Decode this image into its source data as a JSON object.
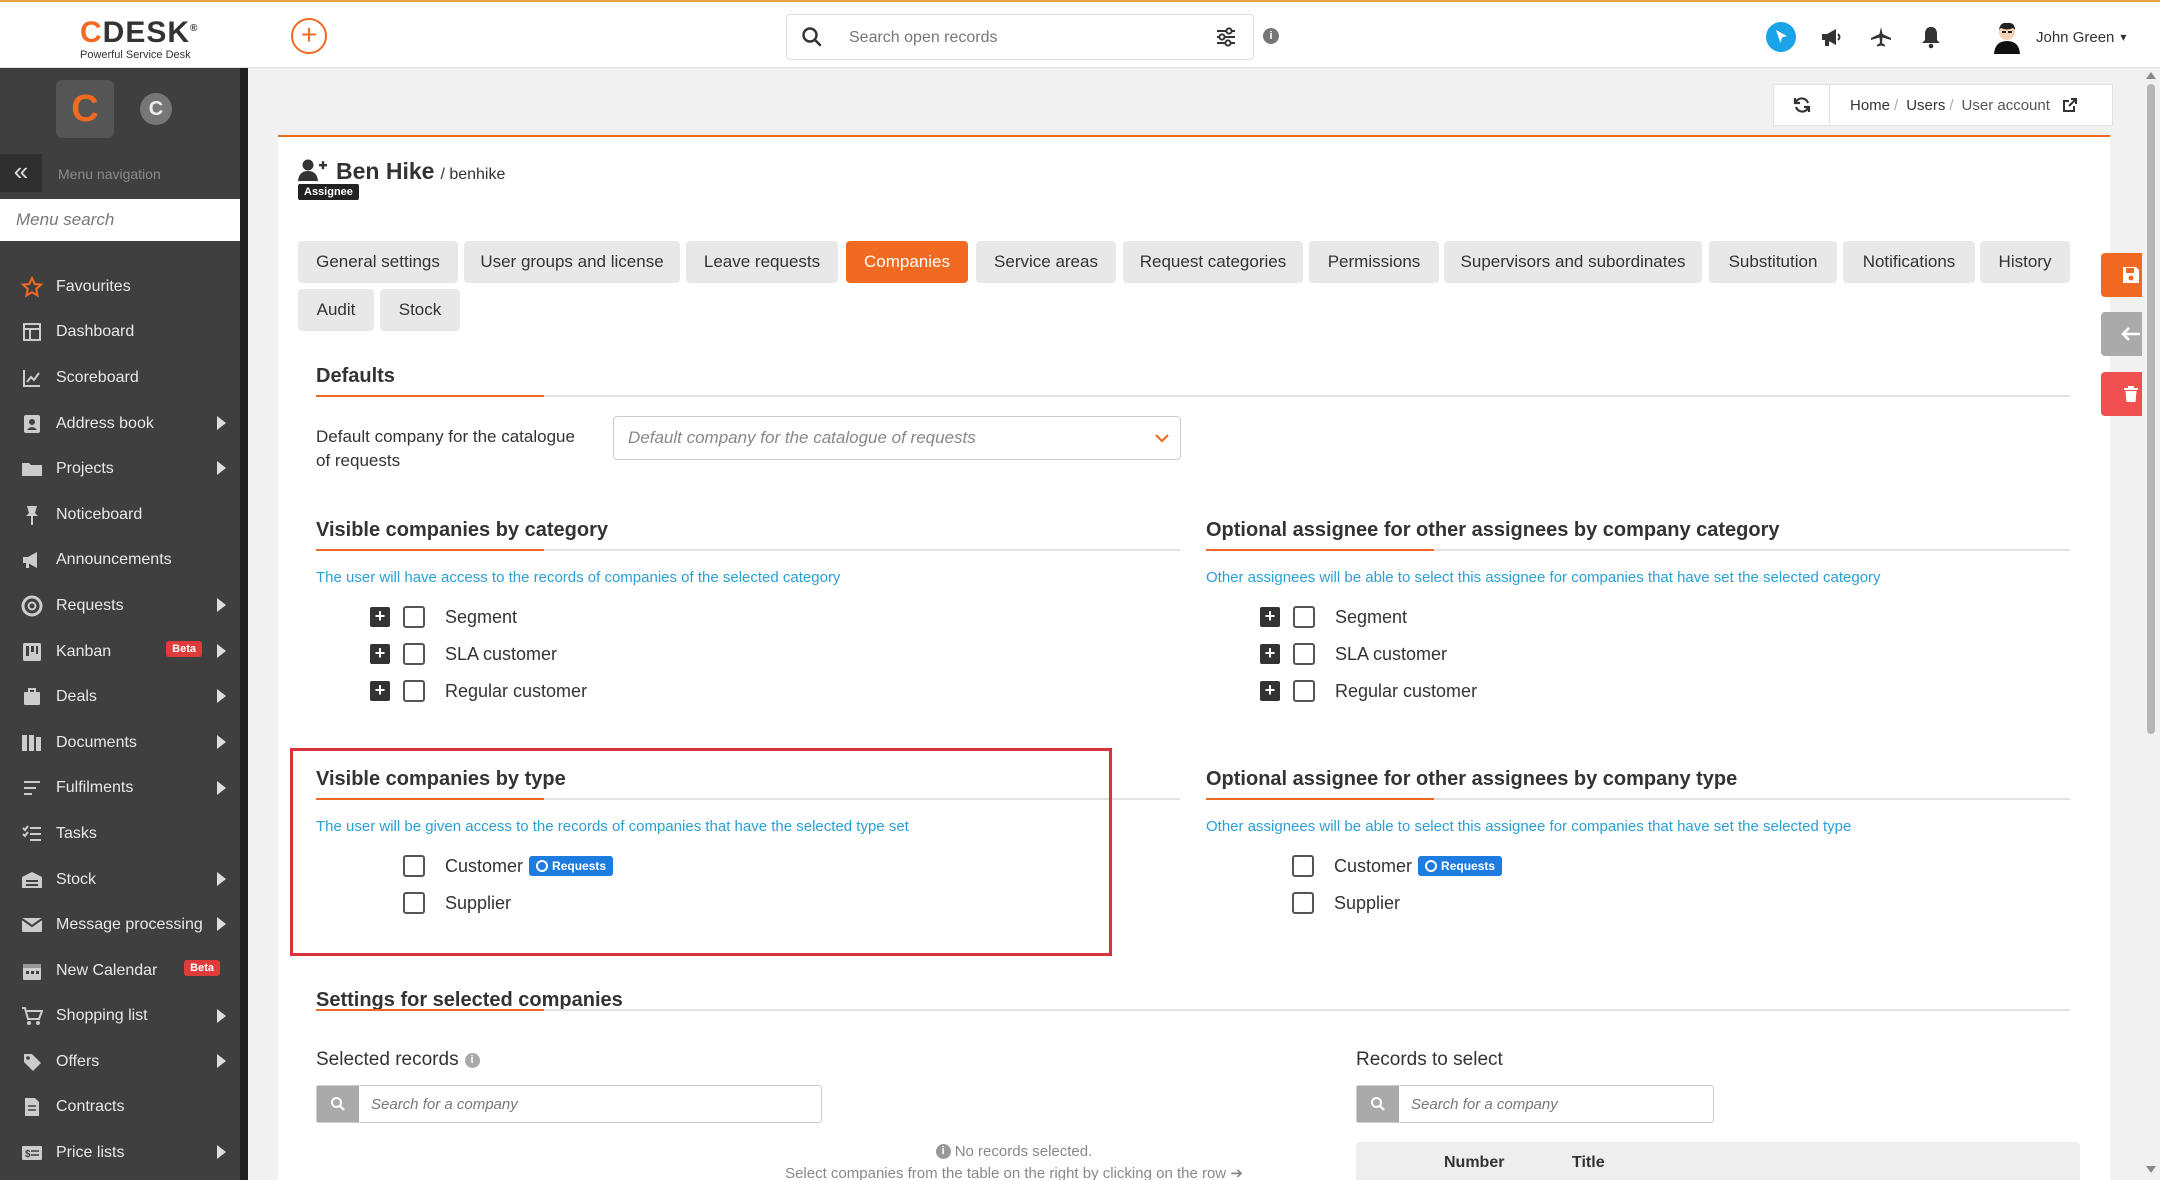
{
  "header": {
    "logo_text": "DESK",
    "logo_letter": "C",
    "logo_reg": "®",
    "logo_tagline": "Powerful Service Desk",
    "add_label": "+",
    "search_placeholder": "Search open records",
    "info_label": "i",
    "user_name": "John Green",
    "user_caret": "▾"
  },
  "sidebar": {
    "logo_letter": "C",
    "small_logo_letter": "C",
    "collapse_label": "«",
    "menu_navigation_label": "Menu navigation",
    "menu_search_placeholder": "Menu search",
    "items": [
      {
        "label": "Favourites",
        "icon": "star-icon",
        "arrow": false
      },
      {
        "label": "Dashboard",
        "icon": "dashboard-icon",
        "arrow": false
      },
      {
        "label": "Scoreboard",
        "icon": "chart-line-icon",
        "arrow": false
      },
      {
        "label": "Address book",
        "icon": "address-book-icon",
        "arrow": true
      },
      {
        "label": "Projects",
        "icon": "projects-icon",
        "arrow": true
      },
      {
        "label": "Noticeboard",
        "icon": "pin-icon",
        "arrow": false
      },
      {
        "label": "Announcements",
        "icon": "megaphone-icon",
        "arrow": false
      },
      {
        "label": "Requests",
        "icon": "lifebuoy-icon",
        "arrow": true
      },
      {
        "label": "Kanban",
        "icon": "kanban-icon",
        "arrow": true,
        "badge": "Beta"
      },
      {
        "label": "Deals",
        "icon": "briefcase-icon",
        "arrow": true
      },
      {
        "label": "Documents",
        "icon": "documents-icon",
        "arrow": true
      },
      {
        "label": "Fulfilments",
        "icon": "fulfilments-icon",
        "arrow": true
      },
      {
        "label": "Tasks",
        "icon": "tasks-icon",
        "arrow": false
      },
      {
        "label": "Stock",
        "icon": "warehouse-icon",
        "arrow": true
      },
      {
        "label": "Message processing",
        "icon": "envelope-icon",
        "arrow": true
      },
      {
        "label": "New Calendar",
        "icon": "calendar-icon",
        "arrow": false,
        "badge": "Beta"
      },
      {
        "label": "Shopping list",
        "icon": "cart-icon",
        "arrow": true
      },
      {
        "label": "Offers",
        "icon": "tag-icon",
        "arrow": true
      },
      {
        "label": "Contracts",
        "icon": "contract-icon",
        "arrow": false
      },
      {
        "label": "Price lists",
        "icon": "price-list-icon",
        "arrow": true
      }
    ]
  },
  "breadcrumb": {
    "items": [
      "Home",
      "Users",
      "User account"
    ],
    "separator": "/"
  },
  "user": {
    "name": "Ben Hike",
    "login": "/ benhike",
    "role": "Assignee"
  },
  "tabs": [
    {
      "label": "General settings",
      "active": false
    },
    {
      "label": "User groups and license",
      "active": false
    },
    {
      "label": "Leave requests",
      "active": false
    },
    {
      "label": "Companies",
      "active": true
    },
    {
      "label": "Service areas",
      "active": false
    },
    {
      "label": "Request categories",
      "active": false
    },
    {
      "label": "Permissions",
      "active": false
    },
    {
      "label": "Supervisors and subordinates",
      "active": false
    },
    {
      "label": "Substitution",
      "active": false
    },
    {
      "label": "Notifications",
      "active": false
    },
    {
      "label": "History",
      "active": false
    },
    {
      "label": "Audit",
      "active": false
    },
    {
      "label": "Stock",
      "active": false
    }
  ],
  "defaults": {
    "title": "Defaults",
    "field_label": "Default company for the catalogue of requests",
    "dropdown_placeholder": "Default company for the catalogue of requests"
  },
  "visible_by_category": {
    "title": "Visible companies by category",
    "description": "The user will have access to the records of companies of the selected category",
    "options": [
      "Segment",
      "SLA customer",
      "Regular customer"
    ],
    "expand_label": "+"
  },
  "optional_by_category": {
    "title": "Optional assignee for other assignees by company category",
    "description": "Other assignees will be able to select this assignee for companies that have set the selected category",
    "options": [
      "Segment",
      "SLA customer",
      "Regular customer"
    ],
    "expand_label": "+"
  },
  "visible_by_type": {
    "title": "Visible companies by type",
    "description": "The user will be given access to the records of companies that have the selected type set",
    "options": [
      "Customer",
      "Supplier"
    ],
    "badge": "Requests"
  },
  "optional_by_type": {
    "title": "Optional assignee for other assignees by company type",
    "description": "Other assignees will be able to select this assignee for companies that have set the selected type",
    "options": [
      "Customer",
      "Supplier"
    ],
    "badge": "Requests"
  },
  "settings_selected": {
    "title": "Settings for selected companies",
    "selected_records_label": "Selected records",
    "records_to_select_label": "Records to select",
    "search_placeholder": "Search for a company",
    "info_label": "i",
    "no_records": "No records selected.",
    "hint": "Select companies from the table on the right by clicking on the row",
    "table_columns": [
      "Number",
      "Title"
    ]
  },
  "colors": {
    "accent": "#f26a21",
    "link_blue": "#2a9fd6",
    "badge_blue": "#1e7be0",
    "highlight_red": "#d9343e",
    "sidebar_bg": "#3f3f3f"
  }
}
